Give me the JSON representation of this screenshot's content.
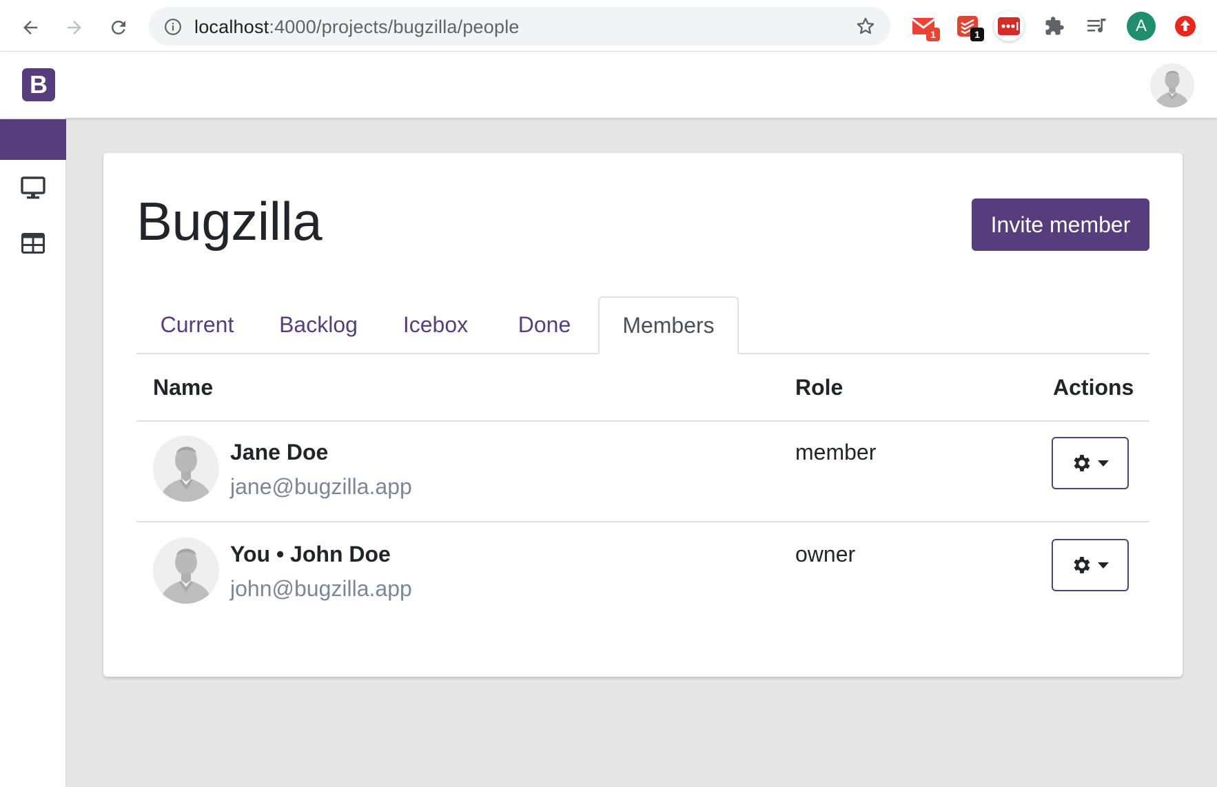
{
  "browser": {
    "url_host": "localhost",
    "url_path": ":4000/projects/bugzilla/people",
    "extensions": [
      {
        "name": "gmail",
        "badge": "1"
      },
      {
        "name": "todoist",
        "badge": "1"
      },
      {
        "name": "lastpass",
        "badge": ""
      },
      {
        "name": "puzzle"
      },
      {
        "name": "media"
      },
      {
        "name": "profile",
        "letter": "A"
      },
      {
        "name": "update"
      }
    ]
  },
  "app": {
    "logo_letter": "B",
    "brand_color": "#563d7c"
  },
  "project": {
    "title": "Bugzilla",
    "invite_label": "Invite member"
  },
  "tabs": [
    {
      "label": "Current"
    },
    {
      "label": "Backlog"
    },
    {
      "label": "Icebox"
    },
    {
      "label": "Done"
    },
    {
      "label": "Members",
      "active": true
    }
  ],
  "table": {
    "headers": {
      "name": "Name",
      "role": "Role",
      "actions": "Actions"
    },
    "rows": [
      {
        "name": "Jane Doe",
        "email": "jane@bugzilla.app",
        "role": "member"
      },
      {
        "name": "You • John Doe",
        "email": "john@bugzilla.app",
        "role": "owner"
      }
    ]
  }
}
